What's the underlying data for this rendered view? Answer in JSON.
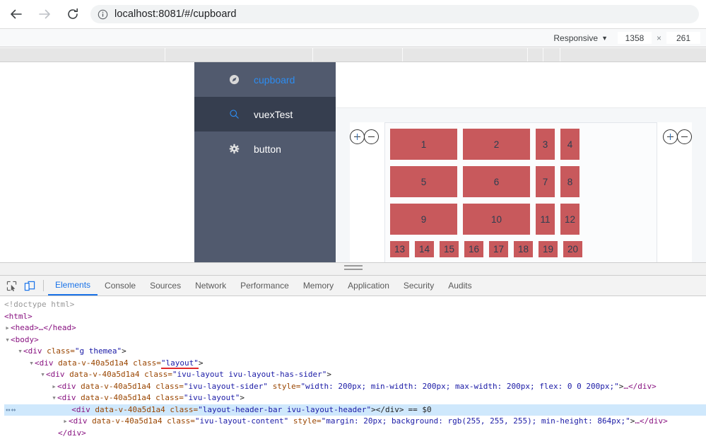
{
  "browser": {
    "back_label": "back-arrow",
    "forward_label": "forward-arrow",
    "reload_label": "reload",
    "info_label": "page-info",
    "url_host": "localhost:8081",
    "url_path": "/#/cupboard",
    "url_full": "localhost:8081/#/cupboard"
  },
  "device_toolbar": {
    "device_name": "Responsive",
    "caret": "▼",
    "width": "1358",
    "separator": "×",
    "height": "261"
  },
  "page": {
    "sidebar": {
      "items": [
        {
          "label": "cupboard",
          "icon": "navigation-icon",
          "active": false,
          "link": true
        },
        {
          "label": "vuexTest",
          "icon": "search-icon",
          "active": true,
          "link": false
        },
        {
          "label": "button",
          "icon": "gear-icon",
          "active": false,
          "link": false
        }
      ]
    },
    "steppers": {
      "left": {
        "plus": "+",
        "minus": "−"
      },
      "right": {
        "plus": "+",
        "minus": "−"
      }
    },
    "grid": {
      "rows": [
        [
          {
            "label": "1",
            "w": "w-lg",
            "h": "h-tall"
          },
          {
            "label": "2",
            "w": "w-lg",
            "h": "h-tall"
          },
          {
            "label": "3",
            "w": "w-sm",
            "h": "h-tall"
          },
          {
            "label": "4",
            "w": "w-sm",
            "h": "h-tall"
          }
        ],
        [
          {
            "label": "5",
            "w": "w-lg",
            "h": "h-tall"
          },
          {
            "label": "6",
            "w": "w-lg",
            "h": "h-tall"
          },
          {
            "label": "7",
            "w": "w-sm",
            "h": "h-tall"
          },
          {
            "label": "8",
            "w": "w-sm",
            "h": "h-tall"
          }
        ],
        [
          {
            "label": "9",
            "w": "w-lg",
            "h": "h-tall"
          },
          {
            "label": "10",
            "w": "w-lg",
            "h": "h-tall"
          },
          {
            "label": "11",
            "w": "w-sm",
            "h": "h-tall"
          },
          {
            "label": "12",
            "w": "w-sm",
            "h": "h-tall"
          }
        ],
        [
          {
            "label": "13",
            "w": "w-sm",
            "h": "h-short"
          },
          {
            "label": "14",
            "w": "w-sm",
            "h": "h-short"
          },
          {
            "label": "15",
            "w": "w-sm",
            "h": "h-short"
          },
          {
            "label": "16",
            "w": "w-sm",
            "h": "h-short"
          },
          {
            "label": "17",
            "w": "w-sm",
            "h": "h-short"
          },
          {
            "label": "18",
            "w": "w-sm",
            "h": "h-short"
          },
          {
            "label": "19",
            "w": "w-sm",
            "h": "h-short"
          },
          {
            "label": "20",
            "w": "w-sm",
            "h": "h-short"
          }
        ]
      ]
    },
    "colors": {
      "sidebar_bg": "#515a6e",
      "sidebar_active_bg": "#363e4f",
      "link_blue": "#2d8cf0",
      "cell_red": "#c8595c",
      "content_bg": "#f5f7f9"
    }
  },
  "devtools": {
    "icons": {
      "inspect": "inspect-element-icon",
      "device": "device-toolbar-icon"
    },
    "tabs": [
      {
        "label": "Elements",
        "active": true
      },
      {
        "label": "Console",
        "active": false
      },
      {
        "label": "Sources",
        "active": false
      },
      {
        "label": "Network",
        "active": false
      },
      {
        "label": "Performance",
        "active": false
      },
      {
        "label": "Memory",
        "active": false
      },
      {
        "label": "Application",
        "active": false
      },
      {
        "label": "Security",
        "active": false
      },
      {
        "label": "Audits",
        "active": false
      }
    ],
    "dom": {
      "l1_doctype": "<!doctype html>",
      "l2_html": "<html>",
      "l3_head": "<head>…</head>",
      "l4_body": "<body>",
      "l5_tag": "<div",
      "l5_attr": "class=",
      "l5_val": "\"g themea\"",
      "l6_tag": "<div",
      "l6_datav": "data-v-40a5d1a4",
      "l6_attr": "class=",
      "l6_val": "\"layout\"",
      "l7_val": "\"ivu-layout ivu-layout-has-sider\"",
      "l8_val": "\"ivu-layout-sider\"",
      "l8_attr2": "style=",
      "l8_val2": "\"width: 200px; min-width: 200px; max-width: 200px; flex: 0 0 200px;\"",
      "l8_tail": "…</div>",
      "l9_val": "\"ivu-layout\"",
      "l10_val": "\"layout-header-bar ivu-layout-header\"",
      "l10_close": "></div>",
      "l10_selected": "== $0",
      "l11_val": "\"ivu-layout-content\"",
      "l11_attr2": "style=",
      "l11_val2": "\"margin: 20px; background: rgb(255, 255, 255); min-height: 864px;\"",
      "l11_tail": "…</div>",
      "l12_close": "</div>",
      "datav": "data-v-40a5d1a4",
      "attr_class": "class=",
      "tri_closed": "▸",
      "tri_open": "▾",
      "selmark": "↔↔"
    }
  }
}
